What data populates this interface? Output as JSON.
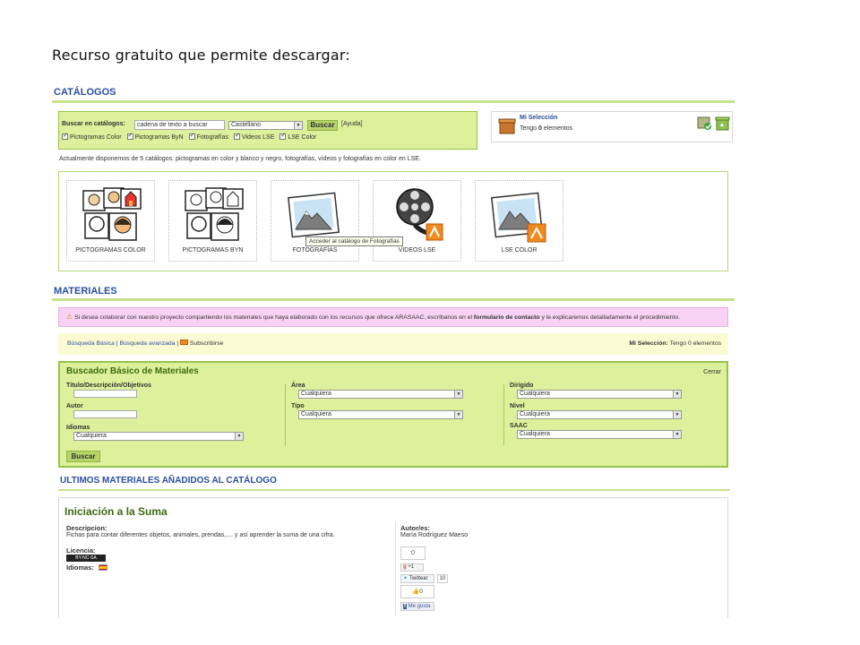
{
  "slide_title": "Recurso gratuito que permite descargar:",
  "catalogos": {
    "title": "CATÁLOGOS",
    "search_label": "Buscar en catálogos:",
    "search_value": "cadena de texto a buscar",
    "language": "Castellano",
    "search_button": "Buscar",
    "help": "[Ayuda]",
    "checkboxes": [
      "Pictogramas Color",
      "Pictogramas ByN",
      "Fotografías",
      "Videos LSE",
      "LSE Color"
    ],
    "info_text": "Actualmente disponemos de 5 catálogos: pictogramas en color y blanco y negro, fotografías, vídeos y fotografías en color en LSE.",
    "cards": [
      {
        "label": "PICTOGRAMAS COLOR",
        "icon": "pictogram-color-icon"
      },
      {
        "label": "PICTOGRAMAS BYN",
        "icon": "pictogram-bw-icon"
      },
      {
        "label": "FOTOGRAFÍAS",
        "icon": "photo-icon"
      },
      {
        "label": "VIDEOS LSE",
        "icon": "film-reel-icon"
      },
      {
        "label": "LSE COLOR",
        "icon": "photo-icon"
      }
    ],
    "tooltip": "Acceder al catálogo de Fotografías"
  },
  "seleccion": {
    "title": "Mi Selección",
    "prefix": "Tengo",
    "count": "0",
    "suffix": "elementos"
  },
  "materiales": {
    "title": "MATERIALES",
    "notice_before": "Si desea colaborar con nuestro proyecto compartiendo los materiales que haya elaborado con los recursos que ofrece ARASAAC, escríbanos en el",
    "notice_link": "formulario de contacto",
    "notice_after": "y le explicaremos detalladamente el procedimiento.",
    "nav_basic": "Búsqueda Básica",
    "nav_sep": "|",
    "nav_advanced": "Búsqueda avanzada",
    "nav_sep2": "|",
    "nav_subscribe": "Subscribirse",
    "selection_label": "Mi Selección:",
    "selection_text": "Tengo 0 elementos"
  },
  "buscador": {
    "title": "Buscador Básico de Materiales",
    "close": "Cerrar",
    "fields": {
      "titulo": "Título/Descripción/Objetivos",
      "autor": "Autor",
      "idiomas": "Idiomas",
      "area": "Área",
      "tipo": "Tipo",
      "dirigido": "Dirigido",
      "nivel": "Nivel",
      "saac": "SAAC"
    },
    "select_value": "Cualquiera",
    "search_button": "Buscar"
  },
  "ultimos": {
    "title": "ULTIMOS MATERIALES AÑADIDOS AL CATÁLOGO",
    "item_title": "Iniciación a la Suma",
    "desc_label": "Descripcion:",
    "desc_text": "Fichas para contar diferentes objetos, animales, prendas,.... y así aprender la suma de una cifra.",
    "licencia_label": "Licencia:",
    "license_badge": "BY-NC-SA",
    "idiomas_label": "Idiomas:",
    "autor_label": "Autor/es:",
    "autor_name": "María Rodríguez Maeso",
    "social": {
      "counter": "0",
      "gplus": "+1",
      "twitter": "Twittear",
      "twitter_count": "10",
      "like_count": "0",
      "facebook": "Me gusta"
    }
  },
  "colors": {
    "accent_green": "#c6e28d",
    "panel_green": "#ddf09b",
    "border_green": "#94c447",
    "heading_blue": "#2a4f9e",
    "title_green": "#3d6b12",
    "notice_pink": "#f8d2f4",
    "nav_yellow": "#fbfad2"
  }
}
